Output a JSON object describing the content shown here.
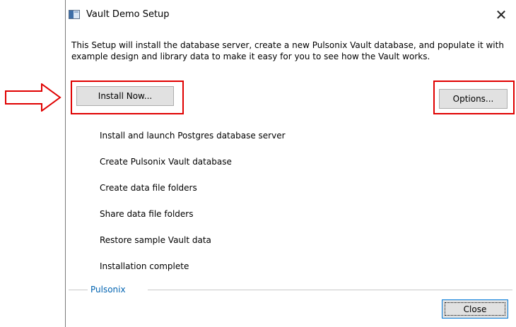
{
  "window": {
    "title": "Vault Demo Setup",
    "close_glyph": "✕"
  },
  "intro_text": "This Setup will install the database server, create a new Pulsonix Vault database, and populate it with example design and library data to make it easy for you to see how the Vault works.",
  "buttons": {
    "install_now": "Install Now...",
    "options": "Options...",
    "close": "Close"
  },
  "steps": [
    "Install and launch Postgres database server",
    "Create Pulsonix Vault database",
    "Create data file folders",
    "Share data file folders",
    "Restore sample Vault data",
    "Installation complete"
  ],
  "group_label": "Pulsonix",
  "colors": {
    "annotation_red": "#e00000",
    "group_label_blue": "#0063b1"
  },
  "icons": [
    "window-app-icon",
    "close-icon",
    "annotation-arrow-icon"
  ]
}
